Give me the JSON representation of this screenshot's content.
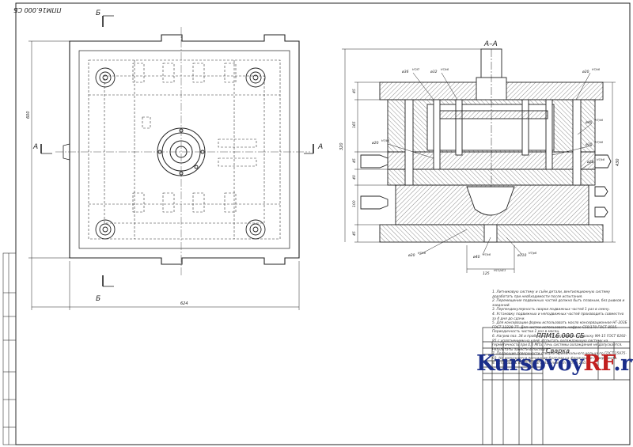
{
  "sheet": {
    "stamp_code": "ППМ16.000 СБ",
    "doc_number": "ППМ16.000 СБ",
    "doc_title": "Сварка",
    "section_b": "Б",
    "section_a": "А",
    "section_title": "А–А",
    "dim_width": "624",
    "dim_height_left": "600",
    "dim_total_right": "430",
    "dim_total_left": "320",
    "dim_bottom": "125",
    "dim_bottom_tol": "H11/d11",
    "dims_v": [
      "45",
      "165",
      "45",
      "40",
      "100",
      "45"
    ],
    "fits": [
      {
        "d": "ø36",
        "f": "H7/f7"
      },
      {
        "d": "ø32",
        "f": "H7/k6"
      },
      {
        "d": "ø20",
        "f": "H7/k6"
      },
      {
        "d": "ø40",
        "f": "H7/k6"
      },
      {
        "d": "ø20",
        "f": "H7/k6"
      },
      {
        "d": "ø20",
        "f": "H7/k6"
      },
      {
        "d": "ø20",
        "f": "H7/k6"
      },
      {
        "d": "ø20",
        "f": "H7/k6"
      },
      {
        "d": "ø40",
        "f": "H7/k6"
      },
      {
        "d": "ø110",
        "f": "H7/p6"
      }
    ]
  },
  "notes": [
    "1. Литниковую систему и съём детали, вентиляционную систему доработать при необходимости после испытания.",
    "2. Перемещение подвижных частей должно быть плавным, без рывков и заеданий.",
    "3. Перпендикулярность сварки подвижных частей 1 раз в смену.",
    "4. Установку подвижных и неподвижных частей производить совместно за 4 дня до сдачи.",
    "5. Для консервации формы использовать масло консервационное НГ-203Б ГОСТ 12328-77. Для чистки использовать нефрас-С50/170 ГОСТ 8505. Периодичность чистки 1 раз в месяц.",
    "6. Нагрев поз. 34 и пробка поз. 15 установить на краску МА-15 ГОСТ 6292-85 с уплотнением на клей. Испытать охлаждающую систему на герметичность при 0,6 МПа. Течь системы охлаждения не допускается. Результаты занести в паспорт.",
    "7. Подающие поверхности створки криминального кольца по ГОСТ 15975-93. Не допускается попадание болтами на формующие поверхности.",
    "8. Установить на Technikal Data Engetech EXTRA 250."
  ],
  "brand": {
    "main": "Kursovoy",
    "accent": "RF",
    "suffix": ".ru"
  }
}
